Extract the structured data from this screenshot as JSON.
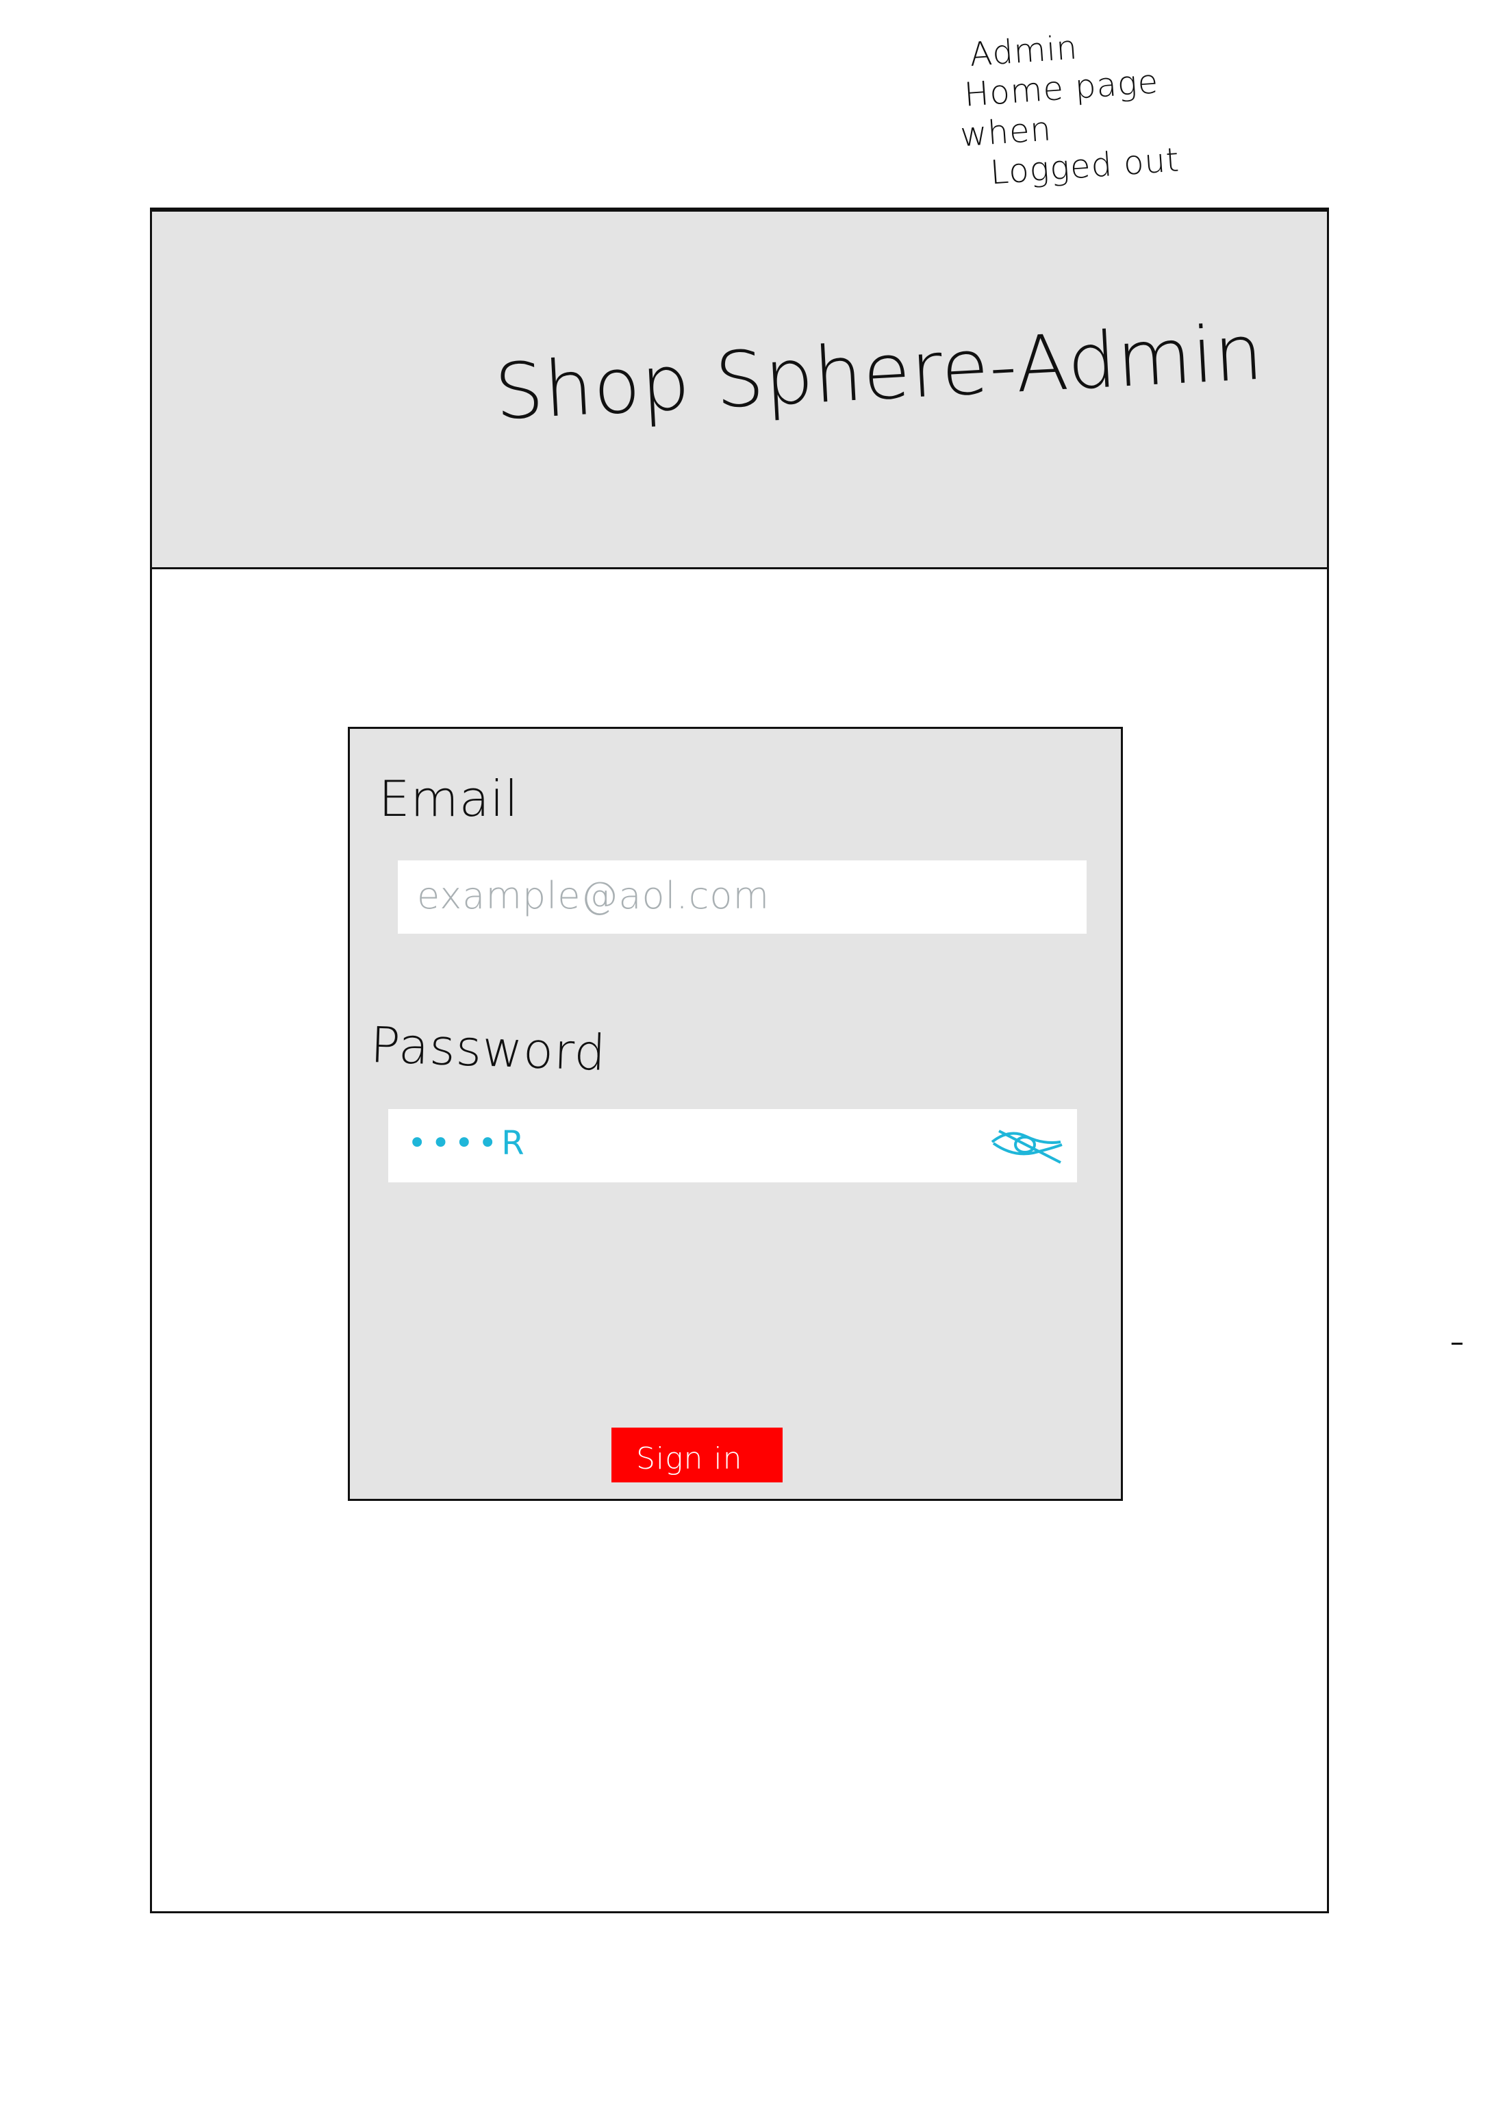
{
  "annotation": {
    "line1": "Admin",
    "line2": "Home page",
    "line3": "when",
    "line4": "Logged out"
  },
  "header": {
    "title": "Shop Sphere-Admin"
  },
  "login": {
    "email_label": "Email",
    "email_placeholder": "example@aol.com",
    "password_label": "Password",
    "password_value": "••••R",
    "signin_label": "Sign in"
  },
  "colors": {
    "header_bg": "#e4e4e4",
    "card_bg": "#e4e4e4",
    "signin_bg": "#ff0000",
    "password_text": "#1fb6d9",
    "placeholder_text": "#a9b0b3"
  },
  "icons": {
    "password_toggle": "eye-slash-icon"
  }
}
